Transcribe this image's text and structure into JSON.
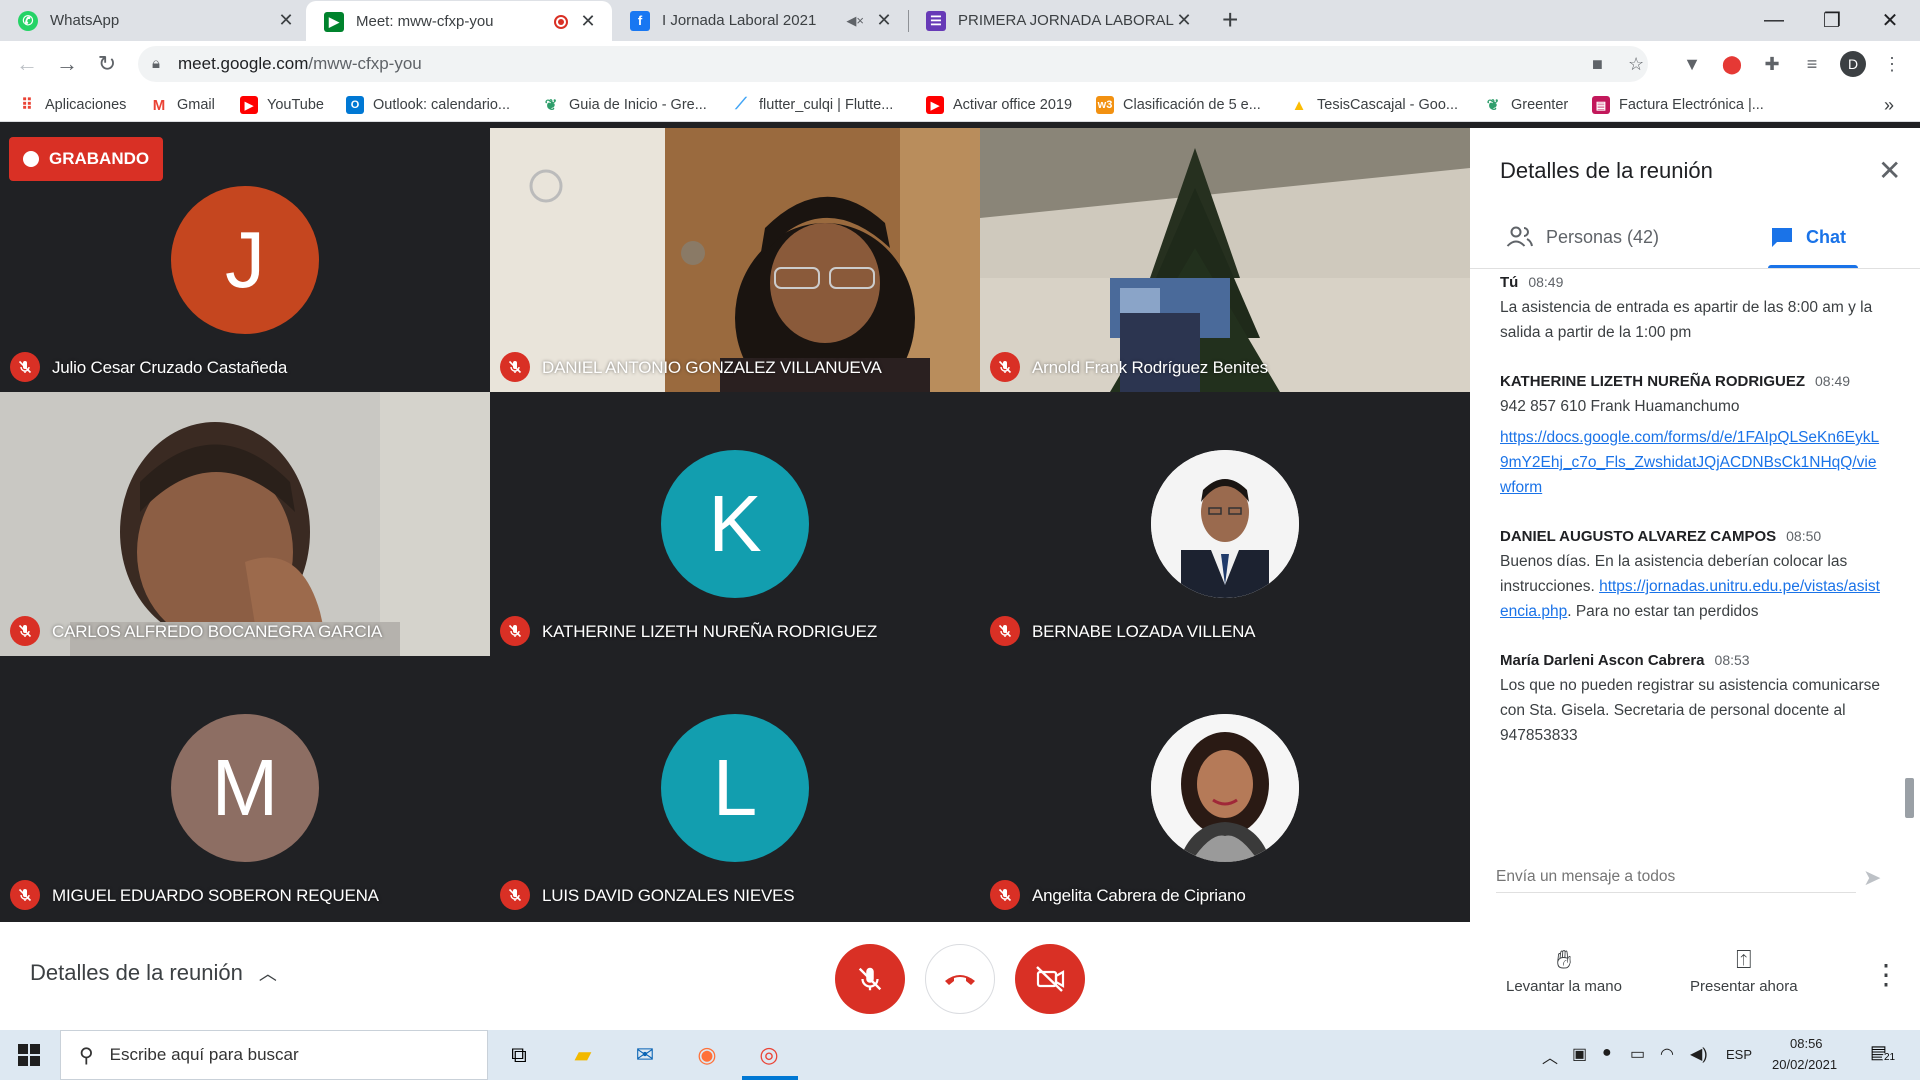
{
  "browser": {
    "tabs": [
      {
        "title": "WhatsApp",
        "icon": "whatsapp-icon",
        "color": "#25d366",
        "active": false
      },
      {
        "title": "Meet: mww-cfxp-you",
        "icon": "google-meet-icon",
        "color": "#00832d",
        "active": true
      },
      {
        "title": "I Jornada Laboral 2021",
        "icon": "facebook-icon",
        "color": "#1877f2",
        "active": false
      },
      {
        "title": "PRIMERA JORNADA LABORAL EX",
        "icon": "google-forms-icon",
        "color": "#673ab7",
        "active": false
      }
    ],
    "url_host": "meet.google.com",
    "url_path": "/mww-cfxp-you",
    "profile_initial": "D",
    "bookmarks": [
      {
        "label": "Aplicaciones",
        "icon": "apps-grid-icon",
        "color": "#ea4335"
      },
      {
        "label": "Gmail",
        "icon": "gmail-icon",
        "color": "#ea4335"
      },
      {
        "label": "YouTube",
        "icon": "youtube-icon",
        "color": "#ff0000"
      },
      {
        "label": "Outlook: calendario...",
        "icon": "outlook-icon",
        "color": "#0078d4"
      },
      {
        "label": "Guia de Inicio - Gre...",
        "icon": "greenter-icon",
        "color": "#2e9e6b"
      },
      {
        "label": "flutter_culqi | Flutte...",
        "icon": "flutter-icon",
        "color": "#42a5f5"
      },
      {
        "label": "Activar office 2019",
        "icon": "youtube-icon",
        "color": "#ff0000"
      },
      {
        "label": "Clasificación de 5 e...",
        "icon": "w3schools-icon",
        "color": "#f29111"
      },
      {
        "label": "TesisCascajal - Goo...",
        "icon": "google-drive-icon",
        "color": "#fbbc04"
      },
      {
        "label": "Greenter",
        "icon": "greenter-icon",
        "color": "#2e9e6b"
      },
      {
        "label": "Factura Electrónica |...",
        "icon": "document-icon",
        "color": "#c2185b"
      }
    ]
  },
  "meet": {
    "recording_label": "GRABANDO",
    "participants": [
      {
        "name": "Julio Cesar Cruzado Castañeda",
        "type": "avatar",
        "initial": "J",
        "color": "#c5461f"
      },
      {
        "name": "DANIEL ANTONIO GONZALEZ VILLANUEVA",
        "type": "video",
        "scene": "woman"
      },
      {
        "name": "Arnold Frank Rodríguez Benites",
        "type": "video",
        "scene": "tree"
      },
      {
        "name": "CARLOS ALFREDO BOCANEGRA GARCIA",
        "type": "video",
        "scene": "man"
      },
      {
        "name": "KATHERINE LIZETH NUREÑA RODRIGUEZ",
        "type": "avatar",
        "initial": "K",
        "color": "#129eaf"
      },
      {
        "name": "BERNABE LOZADA VILLENA",
        "type": "photo",
        "scene": "man-suit"
      },
      {
        "name": "MIGUEL EDUARDO SOBERON REQUENA",
        "type": "avatar",
        "initial": "M",
        "color": "#8d6e63"
      },
      {
        "name": "LUIS DAVID GONZALES NIEVES",
        "type": "avatar",
        "initial": "L",
        "color": "#129eaf"
      },
      {
        "name": "Angelita Cabrera de Cipriano",
        "type": "photo",
        "scene": "woman-photo"
      }
    ],
    "panel": {
      "title": "Detalles de la reunión",
      "people_tab": "Personas (42)",
      "chat_tab": "Chat",
      "messages": [
        {
          "author": "Tú",
          "time": "08:49",
          "parts": [
            {
              "text": "La asistencia de entrada es apartir de las 8:00 am y la salida a partir de la 1:00 pm"
            }
          ]
        },
        {
          "author": "KATHERINE LIZETH NUREÑA RODRIGUEZ",
          "time": "08:49",
          "parts": [
            {
              "text": "942 857 610 Frank Huamanchumo"
            },
            {
              "link": "https://docs.google.com/forms/d/e/1FAIpQLSeKn6EykL9mY2Ehj_c7o_Fls_ZwshidatJQjACDNBsCk1NHqQ/viewform"
            }
          ]
        },
        {
          "author": "DANIEL AUGUSTO ALVAREZ CAMPOS",
          "time": "08:50",
          "parts": [
            {
              "text": "Buenos días. En la asistencia deberían colocar las instrucciones. "
            },
            {
              "link": "https://jornadas.unitru.edu.pe/vistas/asistencia.php",
              "inline": true
            },
            {
              "text": ". Para no estar tan perdidos",
              "inline": true
            }
          ]
        },
        {
          "author": "María Darleni Ascon Cabrera",
          "time": "08:53",
          "parts": [
            {
              "text": "Los que no pueden registrar su asistencia comunicarse con Sta. Gisela. Secretaria de personal docente al 947853833"
            }
          ]
        }
      ],
      "input_placeholder": "Envía un mensaje a todos"
    },
    "bottom": {
      "details_label": "Detalles de la reunión",
      "raise_hand": "Levantar la mano",
      "present_now": "Presentar ahora"
    }
  },
  "taskbar": {
    "search_placeholder": "Escribe aquí para buscar",
    "language": "ESP",
    "time": "08:56",
    "date": "20/02/2021",
    "notifications": "21"
  }
}
